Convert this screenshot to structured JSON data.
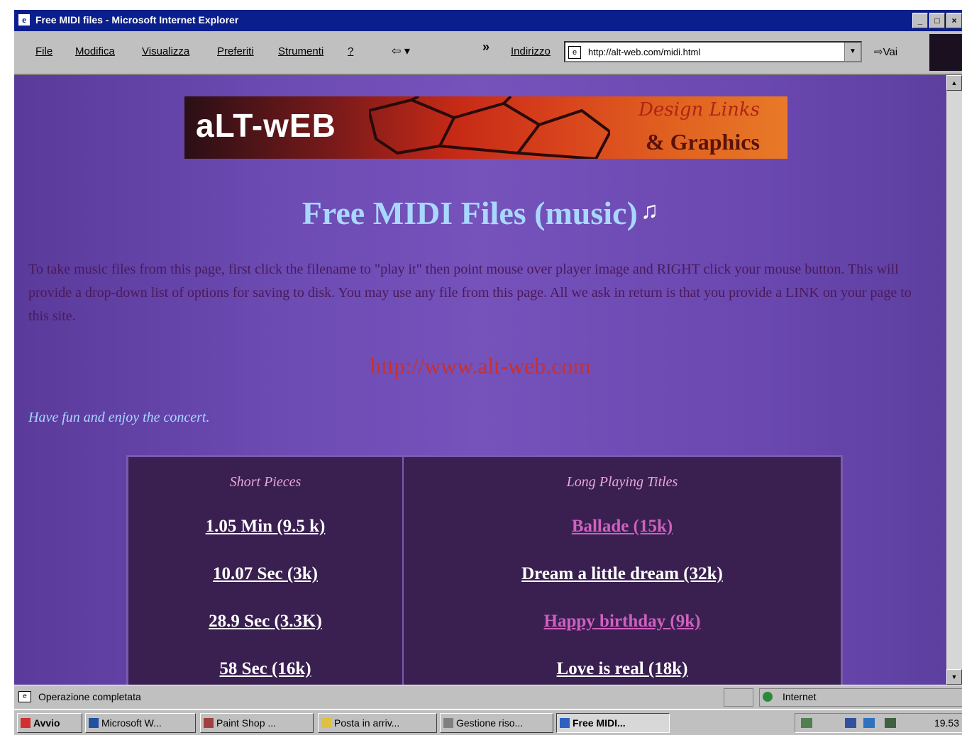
{
  "window": {
    "title": "Free MIDI files - Microsoft Internet Explorer",
    "buttons": [
      "_",
      "□",
      "×"
    ]
  },
  "menubar": {
    "items": [
      "File",
      "Modifica",
      "Visualizza",
      "Preferiti",
      "Strumenti",
      "?"
    ],
    "back_glyph": "⇦ ▾",
    "separator": "»",
    "address_label": "Indirizzo",
    "address_url": "http://alt-web.com/midi.html",
    "go_label": "⇨Vai"
  },
  "page": {
    "banner_logo": "aLT-wEB",
    "banner_script": "Design Links",
    "banner_graphics": "& Graphics",
    "heading": "Free MIDI Files (music)",
    "note_glyph": "♫",
    "intro": "To take music files from this page, first click the filename to \"play it\" then point mouse over player image and RIGHT click your mouse button. This will provide a drop-down list of options for saving to disk. You may use any file from this page. All we ask in return is that you provide a LINK on your page to this site.",
    "site_link": "http://www.alt-web.com",
    "enjoy": "Have fun and enjoy the concert.",
    "table": {
      "short_header": "Short Pieces",
      "long_header": "Long Playing Titles",
      "short_items": [
        "1.05 Min (9.5 k)",
        "10.07 Sec (3k)",
        "28.9 Sec (3.3K)",
        "58 Sec (16k)"
      ],
      "long_items": [
        "Ballade (15k)",
        "Dream a little dream (32k)",
        "Happy birthday (9k)",
        "Love is real (18k)"
      ]
    }
  },
  "statusbar": {
    "text": "Operazione completata",
    "zone": "Internet"
  },
  "taskbar": {
    "start": "Avvio",
    "tasks": [
      "Microsoft W...",
      "Paint Shop ...",
      "Posta in arriv...",
      "Gestione riso...",
      "Free MIDI..."
    ],
    "clock": "19.53"
  },
  "colors": {
    "page_bg": "#6a48b0",
    "heading": "#a8d8ff",
    "intro_text": "#4a1a5a",
    "site_link": "#c83030",
    "table_bg": "#3a2050",
    "visited_link": "#d060c0",
    "link": "#ffffff"
  }
}
